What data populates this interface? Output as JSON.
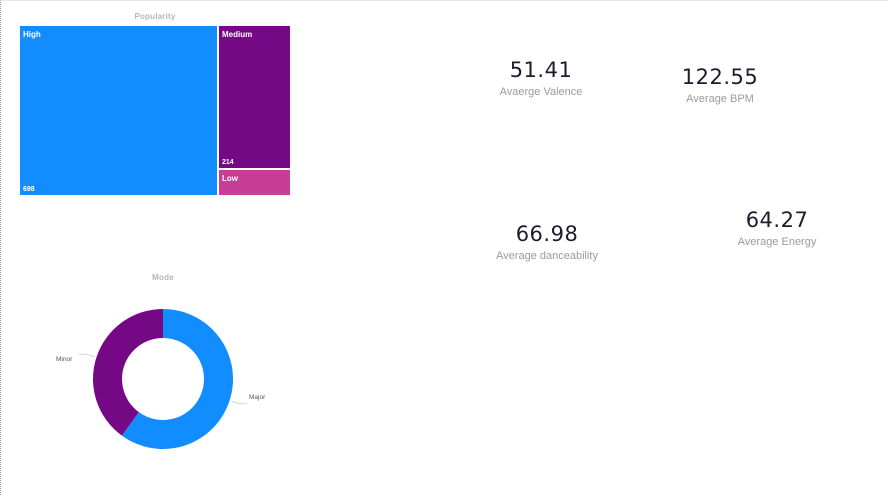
{
  "treemap": {
    "title": "Popularity",
    "tiles": [
      {
        "name": "High",
        "value": "698",
        "color": "#118DFF"
      },
      {
        "name": "Medium",
        "value": "214",
        "color": "#750985"
      },
      {
        "name": "Low",
        "value": "",
        "color": "#C83D95"
      }
    ]
  },
  "cards": {
    "valence": {
      "value": "51.41",
      "label": "Avaerge Valence"
    },
    "bpm": {
      "value": "122.55",
      "label": "Average BPM"
    },
    "danceability": {
      "value": "66.98",
      "label": "Average danceability"
    },
    "energy": {
      "value": "64.27",
      "label": "Average Energy"
    }
  },
  "donut": {
    "title": "Mode",
    "slices": [
      {
        "name": "Major",
        "fraction": 0.6,
        "color": "#118DFF"
      },
      {
        "name": "Minor",
        "fraction": 0.4,
        "color": "#750985"
      }
    ]
  }
}
